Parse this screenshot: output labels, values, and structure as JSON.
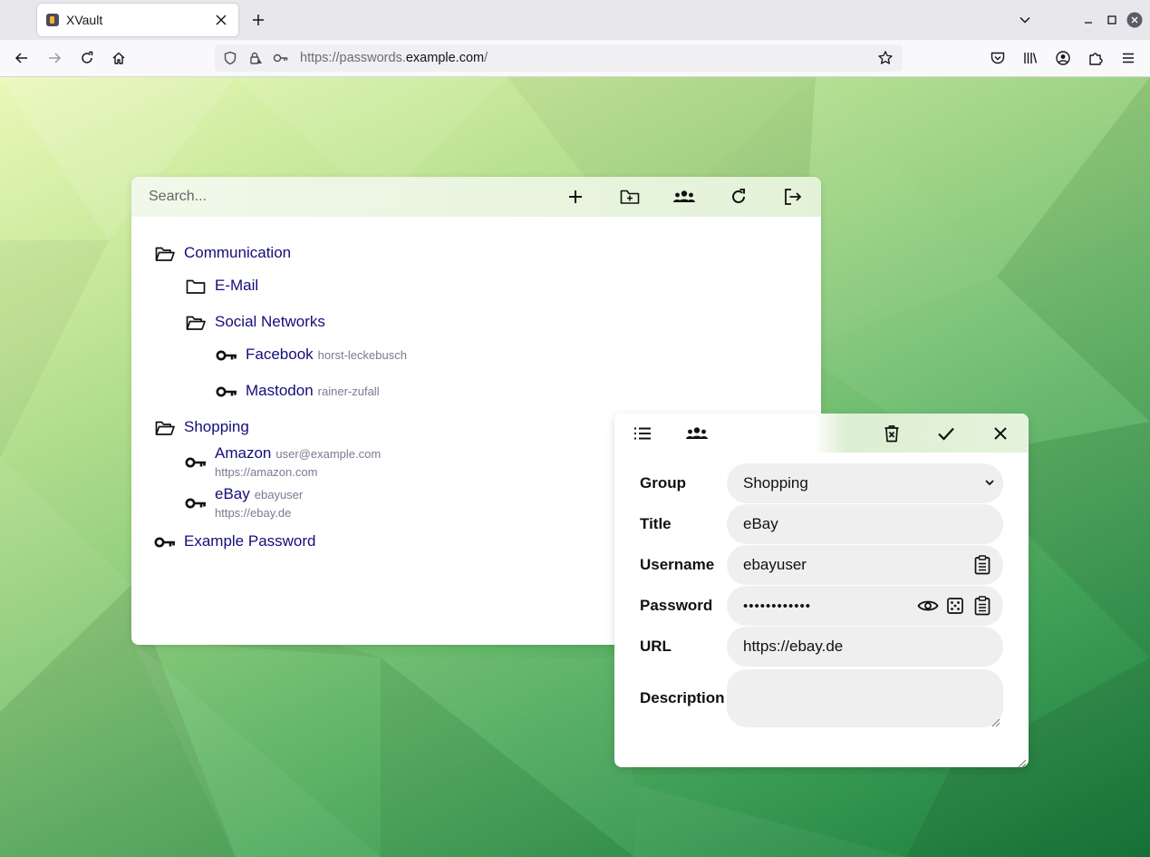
{
  "browser": {
    "tab_title": "XVault",
    "url_prefix": "https://passwords.",
    "url_host": "example.com",
    "url_suffix": "/"
  },
  "main": {
    "search_placeholder": "Search...",
    "tree": [
      {
        "kind": "folder-open",
        "label": "Communication"
      },
      {
        "kind": "folder",
        "label": "E-Mail"
      },
      {
        "kind": "folder-open",
        "label": "Social Networks"
      },
      {
        "kind": "key",
        "label": "Facebook",
        "username": "horst-leckebusch"
      },
      {
        "kind": "key",
        "label": "Mastodon",
        "username": "rainer-zufall"
      },
      {
        "kind": "folder-open",
        "label": "Shopping"
      },
      {
        "kind": "key",
        "label": "Amazon",
        "username": "user@example.com",
        "url": "https://amazon.com"
      },
      {
        "kind": "key",
        "label": "eBay",
        "username": "ebayuser",
        "url": "https://ebay.de"
      },
      {
        "kind": "key",
        "label": "Example Password"
      }
    ]
  },
  "dialog": {
    "fields": {
      "group_label": "Group",
      "group_value": "Shopping",
      "title_label": "Title",
      "title_value": "eBay",
      "username_label": "Username",
      "username_value": "ebayuser",
      "password_label": "Password",
      "password_value": "••••••••••••",
      "url_label": "URL",
      "url_value": "https://ebay.de",
      "description_label": "Description",
      "description_value": ""
    }
  }
}
